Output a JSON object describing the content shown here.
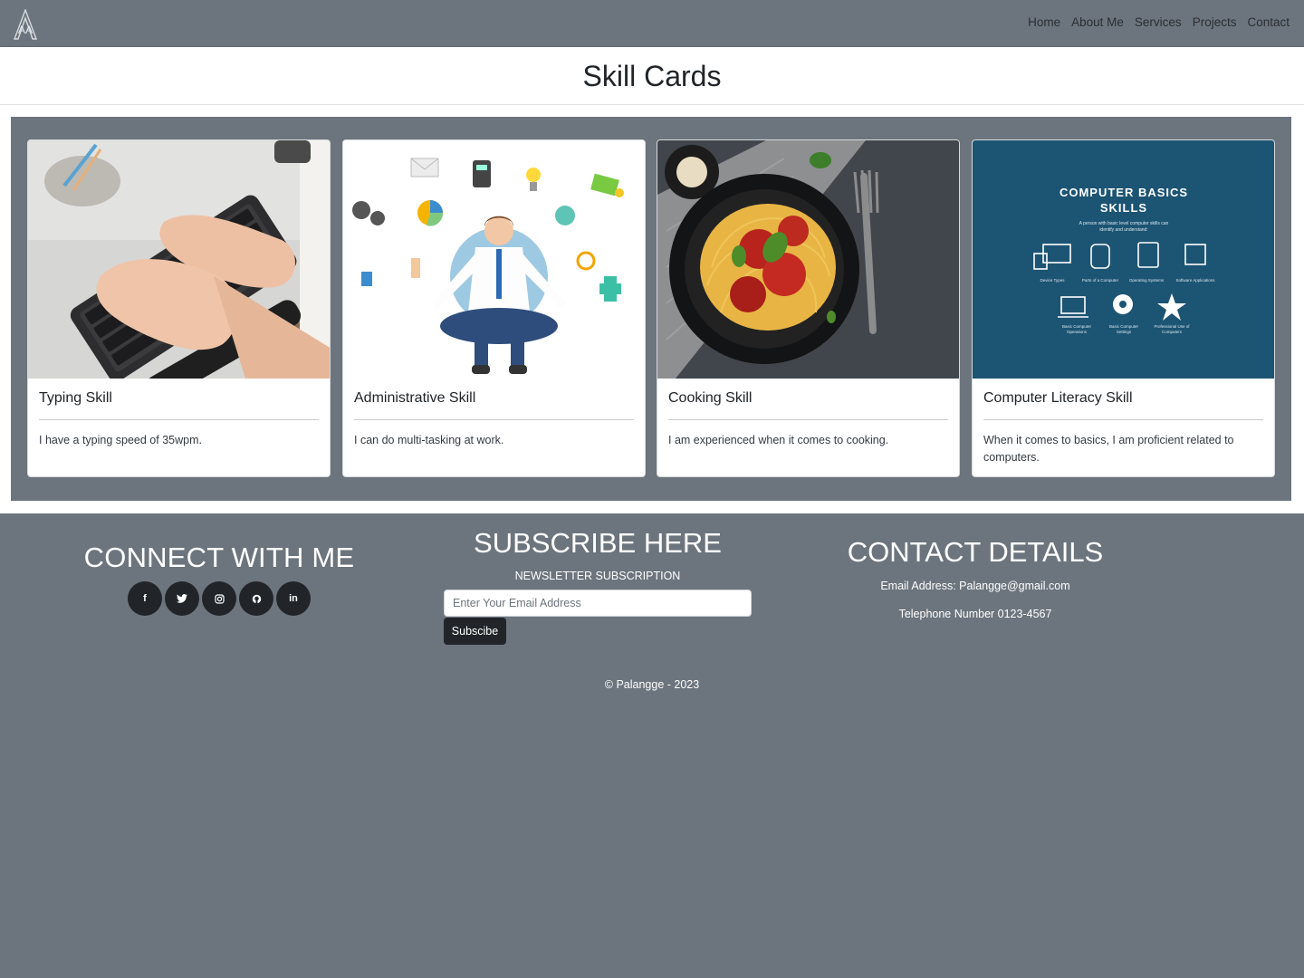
{
  "nav": {
    "logo_text": "AA",
    "links": [
      "Home",
      "About Me",
      "Services",
      "Projects",
      "Contact"
    ]
  },
  "page_title": "Skill Cards",
  "cards": [
    {
      "title": "Typing Skill",
      "text": "I have a typing speed of 35wpm.",
      "image_icon": "keyboard-hands-photo"
    },
    {
      "title": "Administrative Skill",
      "text": "I can do multi-tasking at work.",
      "image_icon": "meditating-businessman-illustration"
    },
    {
      "title": "Cooking Skill",
      "text": "I am experienced when it comes to cooking.",
      "image_icon": "spaghetti-plate-photo"
    },
    {
      "title": "Computer Literacy Skill",
      "text": "When it comes to basics, I am proficient related to computers.",
      "image_icon": "computer-basics-infographic",
      "infographic": {
        "heading_1": "COMPUTER BASICS",
        "heading_2": "SKILLS",
        "subtitle_1": "A person with basic level computer skills can",
        "subtitle_2": "identify and understand:",
        "items": [
          "Device Types",
          "Parts of a Computer",
          "Operating Systems",
          "Software Applications"
        ],
        "items2_line1": [
          "Basic Computer",
          "Basic Computer",
          "Professional Use of"
        ],
        "items2_line2": [
          "Operations",
          "Settings",
          "Computers"
        ]
      }
    }
  ],
  "footer": {
    "connect_title": "CONNECT WITH ME",
    "socials": [
      {
        "icon": "facebook-icon",
        "glyph": "f"
      },
      {
        "icon": "twitter-icon",
        "glyph": "t"
      },
      {
        "icon": "instagram-icon",
        "glyph": "◎"
      },
      {
        "icon": "github-icon",
        "glyph": "◉"
      },
      {
        "icon": "linkedin-icon",
        "glyph": "in"
      }
    ],
    "subscribe_title": "SUBSCRIBE HERE",
    "subscribe_label": "NEWSLETTER SUBSCRIPTION",
    "email_placeholder": "Enter Your Email Address",
    "subscribe_button": "Subscibe",
    "contact_title": "CONTACT DETAILS",
    "email_line": "Email Address: Palangge@gmail.com",
    "phone_line": "Telephone Number 0123-4567",
    "copyright": "© Palangge - 2023"
  },
  "colors": {
    "background": "#6c757d",
    "dark": "#212529",
    "infographic_bg": "#1c5473"
  }
}
